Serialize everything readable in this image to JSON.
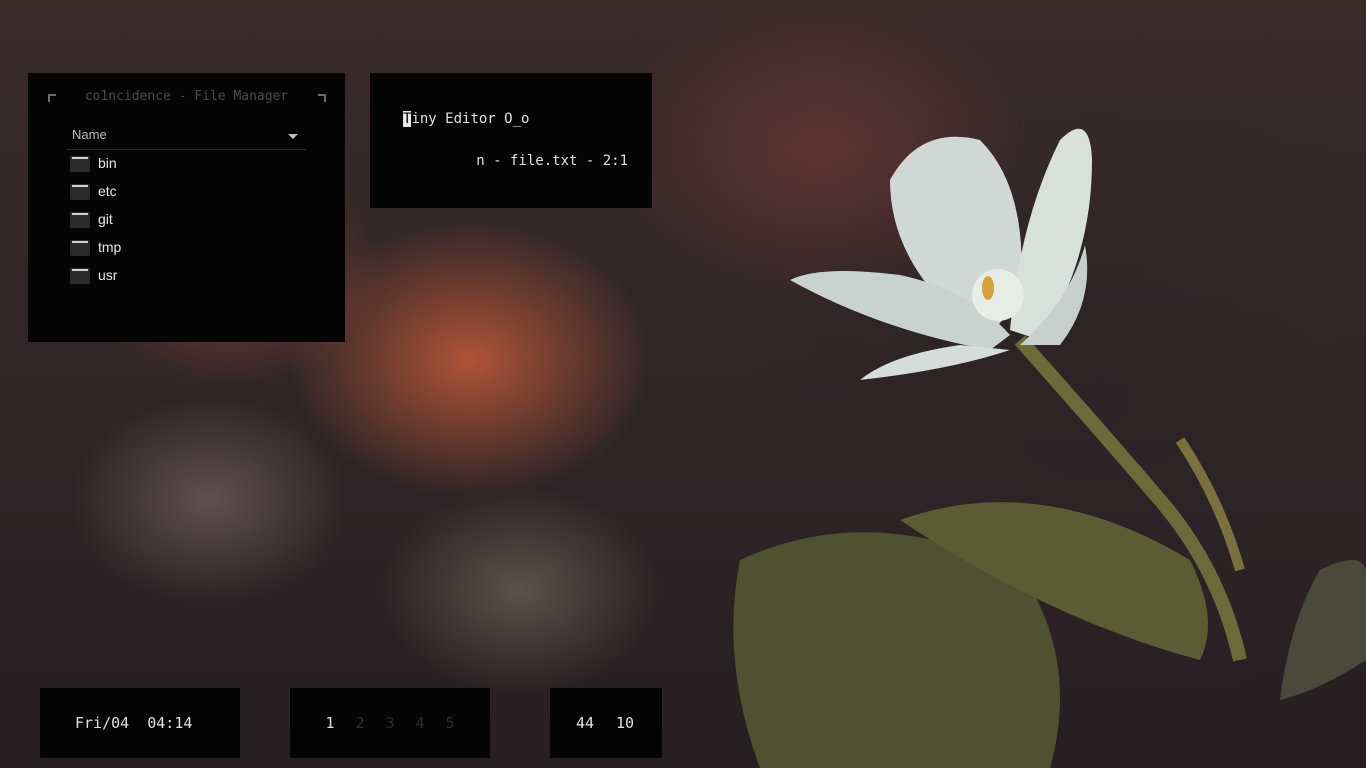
{
  "file_manager": {
    "title": "co1ncidence - File Manager",
    "column_header": "Name",
    "items": [
      {
        "name": "bin"
      },
      {
        "name": "etc"
      },
      {
        "name": "git"
      },
      {
        "name": "tmp"
      },
      {
        "name": "usr"
      }
    ]
  },
  "editor": {
    "cursor_char": "T",
    "text_rest": "iny Editor O_o",
    "status": "n - file.txt - 2:1"
  },
  "clock": {
    "text": "Fri/04  04:14"
  },
  "workspaces": [
    {
      "label": "1",
      "active": true
    },
    {
      "label": "2",
      "active": false
    },
    {
      "label": "3",
      "active": false
    },
    {
      "label": "4",
      "active": false
    },
    {
      "label": "5",
      "active": false
    }
  ],
  "stats": {
    "value_a": "44",
    "value_b": "10"
  },
  "colors": {
    "panel_bg": "#050505",
    "text": "#e0e0e0",
    "inactive_workspace": "#2e2e2e"
  }
}
